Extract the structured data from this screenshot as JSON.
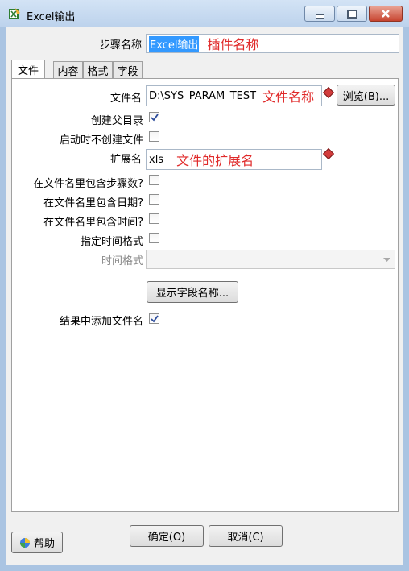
{
  "window": {
    "title": "Excel输出"
  },
  "form": {
    "step_name_label": "步骤名称",
    "step_name_value": "Excel输出",
    "step_name_note": "插件名称"
  },
  "tabs": [
    {
      "label": "文件"
    },
    {
      "label": "内容"
    },
    {
      "label": "格式"
    },
    {
      "label": "字段"
    }
  ],
  "file_tab": {
    "filename_label": "文件名",
    "filename_value": "D:\\SYS_PARAM_TEST",
    "filename_note": "文件名称",
    "browse_button": "浏览(B)...",
    "create_parent_label": "创建父目录",
    "create_parent_checked": true,
    "no_create_on_start_label": "启动时不创建文件",
    "no_create_on_start_checked": false,
    "extension_label": "扩展名",
    "extension_value": "xls",
    "extension_note": "文件的扩展名",
    "include_stepnr_label": "在文件名里包含步骤数?",
    "include_stepnr_checked": false,
    "include_date_label": "在文件名里包含日期?",
    "include_date_checked": false,
    "include_time_label": "在文件名里包含时间?",
    "include_time_checked": false,
    "specify_time_format_label": "指定时间格式",
    "specify_time_format_checked": false,
    "time_format_label": "时间格式",
    "time_format_value": "",
    "show_fields_button": "显示字段名称...",
    "add_to_result_label": "结果中添加文件名",
    "add_to_result_checked": true
  },
  "footer": {
    "help_button": "帮助",
    "ok_button": "确定(O)",
    "cancel_button": "取消(C)"
  }
}
